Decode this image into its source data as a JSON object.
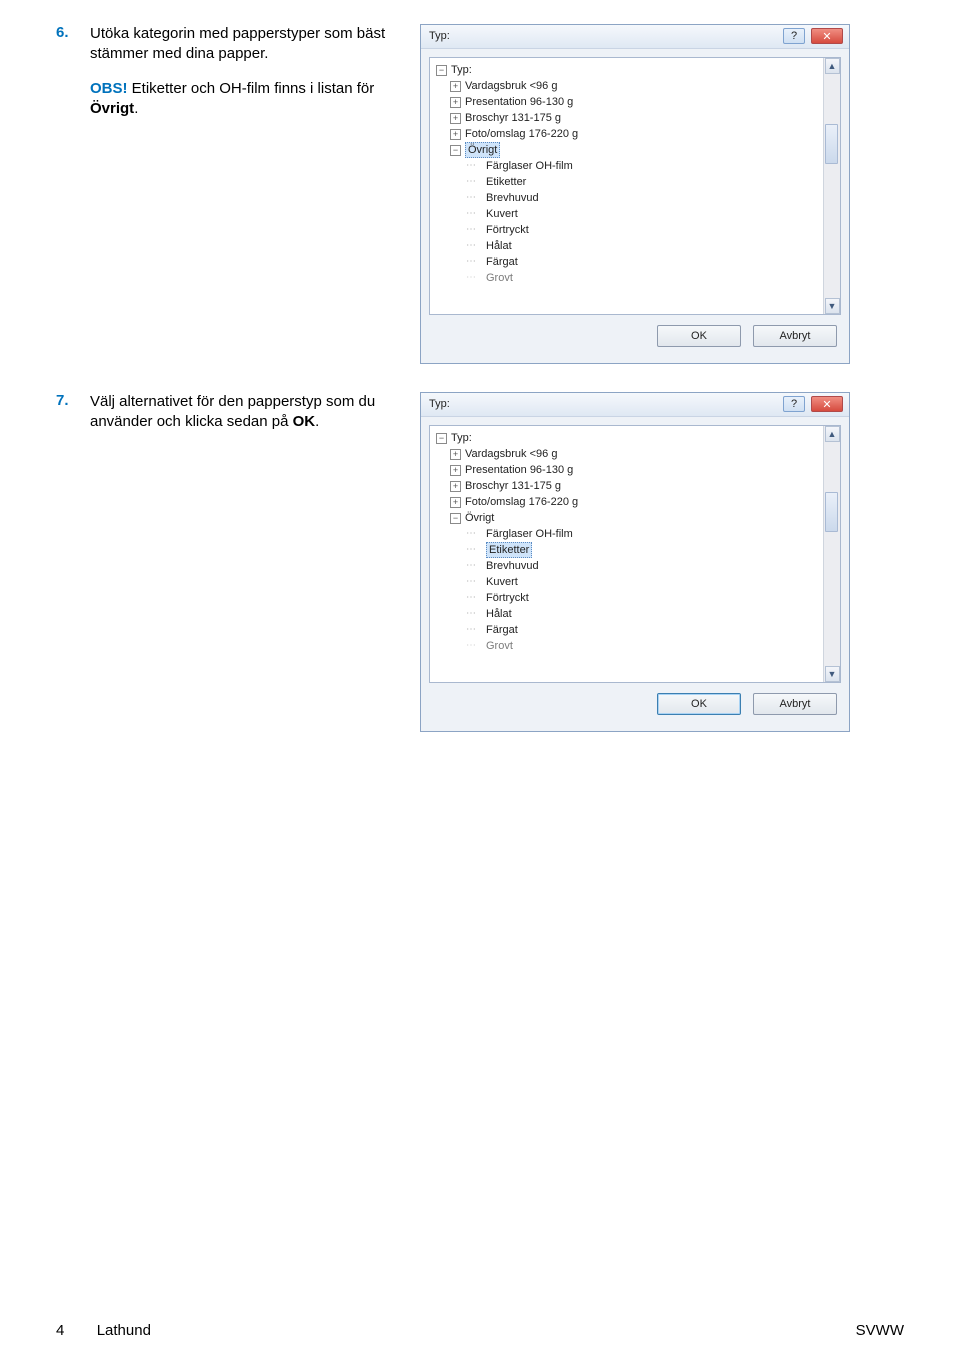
{
  "steps": [
    {
      "num": "6.",
      "text_parts": [
        "Utöka kategorin med papperstyper som bäst stämmer med dina papper."
      ],
      "note_label": "OBS!",
      "note_text": "Etiketter och OH-film finns i listan för ",
      "note_bold": "Övrigt",
      "note_end": "."
    },
    {
      "num": "7.",
      "text_parts": [
        "Välj alternativet för den papperstyp som du använder och klicka sedan på "
      ],
      "bold_inline": "OK",
      "text_end": "."
    }
  ],
  "dialog": {
    "title": "Typ:",
    "help_glyph": "?",
    "close_glyph": "✕",
    "ok_label": "OK",
    "cancel_label": "Avbryt",
    "root_label": "Typ:",
    "scroll_up": "▲",
    "scroll_down": "▼",
    "items_l1": [
      "Vardagsbruk <96 g",
      "Presentation 96-130 g",
      "Broschyr 131-175 g",
      "Foto/omslag 176-220 g",
      "Övrigt"
    ],
    "items_l2": [
      "Färglaser OH-film",
      "Etiketter",
      "Brevhuvud",
      "Kuvert",
      "Förtryckt",
      "Hålat",
      "Färgat",
      "Grovt"
    ],
    "selected_a": "Övrigt",
    "selected_b": "Etiketter"
  },
  "footer": {
    "page": "4",
    "section": "Lathund",
    "right": "SVWW"
  }
}
